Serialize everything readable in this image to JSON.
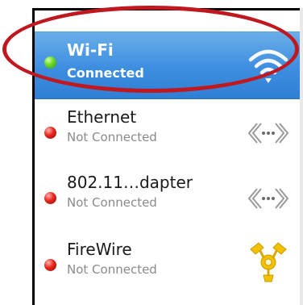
{
  "services": [
    {
      "name": "Wi‑Fi",
      "status": "Connected",
      "state": "connected",
      "icon": "wifi-icon",
      "selected": true
    },
    {
      "name": "Ethernet",
      "status": "Not Connected",
      "state": "disconnected",
      "icon": "ethernet-icon",
      "selected": false
    },
    {
      "name": "802.11…dapter",
      "status": "Not Connected",
      "state": "disconnected",
      "icon": "ethernet-icon",
      "selected": false
    },
    {
      "name": "FireWire",
      "status": "Not Connected",
      "state": "disconnected",
      "icon": "firewire-icon",
      "selected": false
    }
  ],
  "colors": {
    "selection": "#3d8de0",
    "connected_dot": "#6fdc2a",
    "disconnected_dot": "#e8251b",
    "annotation_ellipse": "#c0181f",
    "firewire_icon": "#f2c200"
  }
}
